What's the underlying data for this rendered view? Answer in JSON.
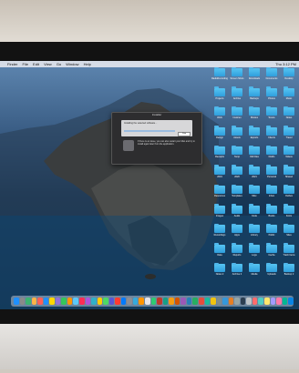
{
  "menubar": {
    "apple": "",
    "items": [
      "Finder",
      "File",
      "Edit",
      "View",
      "Go",
      "Window",
      "Help"
    ],
    "clock": "Thu 3:12 PM"
  },
  "dialog": {
    "title": "Installer",
    "panel_text": "Installing the selected software...",
    "button_label": "Stop",
    "body_text": "If there is an issue, you can also restart your Mac and try to install again later from the application."
  },
  "desktop": {
    "icon_names": [
      "RadioRecordings",
      "Screen Shots",
      "Downloads",
      "Documents",
      "Desktop",
      "Projects",
      "Archive",
      "Backups",
      "Photos",
      "Music",
      "Work",
      "Invoices",
      "Movies",
      "Scans",
      "Notes",
      "Design",
      "Assets",
      "Exports",
      "Clients",
      "Travel",
      "Receipts",
      "Temp",
      "Old Files",
      "Drafts",
      "Videos",
      "2019",
      "2020",
      "2021",
      "Personal",
      "Shared",
      "Resources",
      "Templates",
      "Misc",
      "Inbox",
      "Outbox",
      "Images",
      "Audio",
      "Code",
      "Books",
      "Fonts",
      "Recordings",
      "Apps",
      "Library",
      "Public",
      "Sites",
      "Data",
      "Reports",
      "Logs",
      "Cache",
      "Trash Items",
      "Notes 2",
      "Archive 2",
      "Media",
      "Uploads",
      "Backup 2"
    ]
  },
  "dock": {
    "icons": [
      "#1e90ff",
      "#8a8a8a",
      "#3cb371",
      "#ffb347",
      "#ff5f57",
      "#1e90ff",
      "#ffd700",
      "#9370db",
      "#34c759",
      "#ff9500",
      "#5ac8fa",
      "#ff2d55",
      "#af52de",
      "#30b0c7",
      "#ffcc00",
      "#4cd964",
      "#5856d6",
      "#ff3b30",
      "#007aff",
      "#8e8e93",
      "#34aadc",
      "#ff9500",
      "#e5e5ea",
      "#2ecc71",
      "#c0392b",
      "#16a085",
      "#f39c12",
      "#d35400",
      "#9b59b6",
      "#2980b9",
      "#27ae60",
      "#e74c3c",
      "#1abc9c",
      "#f1c40f",
      "#7f8c8d",
      "#3498db",
      "#e67e22",
      "#95a5a6",
      "#2c3e50",
      "#bdc3c7",
      "#ff6b6b",
      "#4ecdc4",
      "#ffe66d",
      "#a29bfe",
      "#fd79a8",
      "#00b894",
      "#0984e3"
    ]
  }
}
